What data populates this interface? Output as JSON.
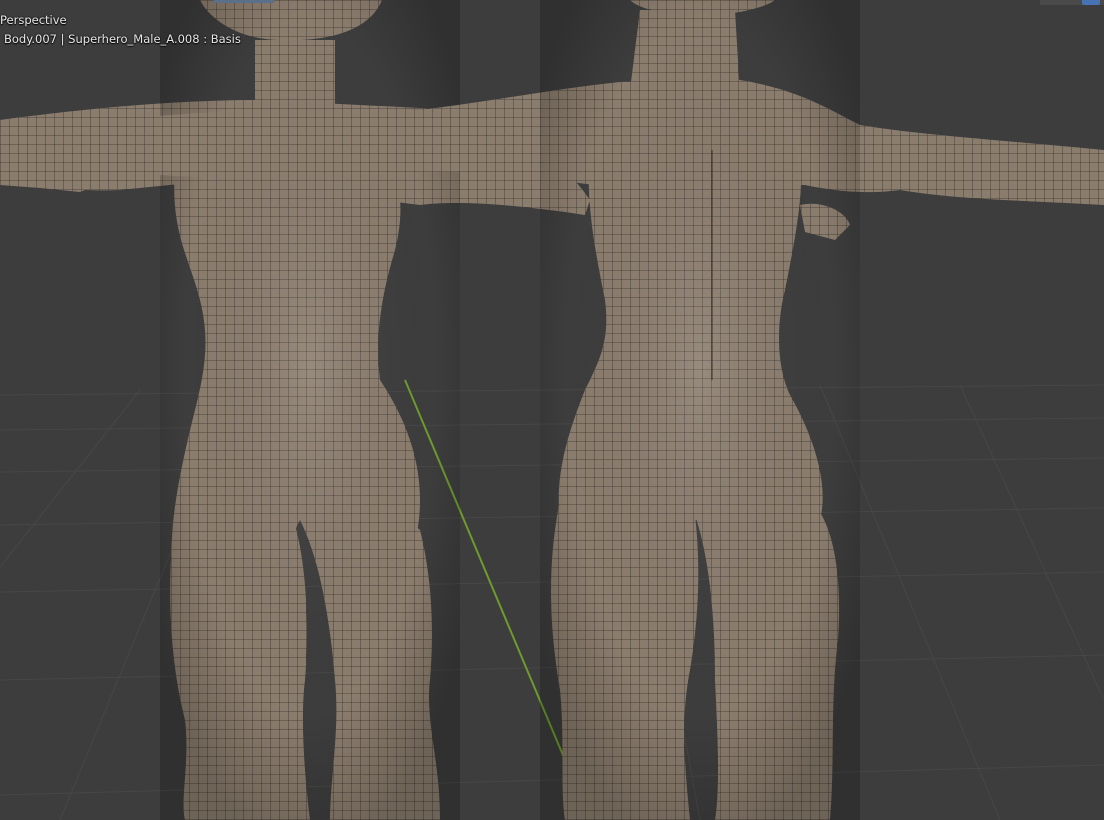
{
  "viewport": {
    "view_mode": "Perspective",
    "object_info": "Body.007 | Superhero_Male_A.008 : Basis"
  },
  "colors": {
    "background": "#3d3d3d",
    "grid_line": "#4a4a4a",
    "y_axis": "#6e9a2e",
    "skin": "#8b7d6e",
    "wire": "#3a322b",
    "text": "#e8e8e8"
  },
  "icons": {
    "corner_toggle": "viewport-toggle-icon"
  }
}
